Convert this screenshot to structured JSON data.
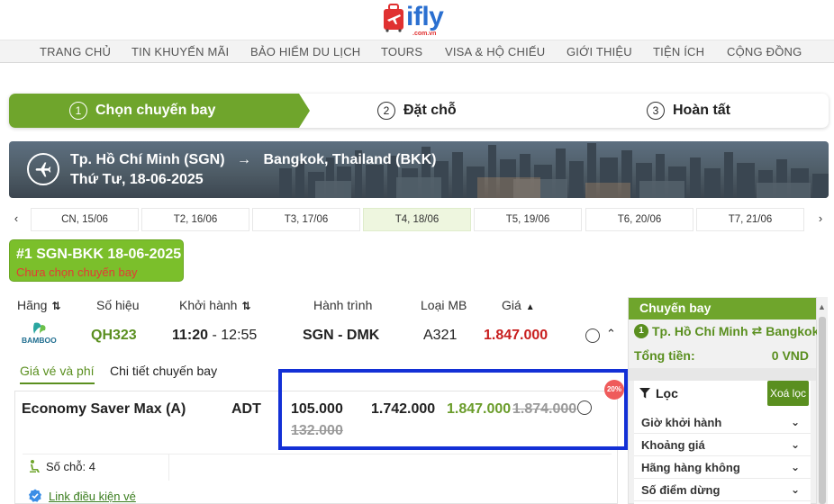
{
  "brand": {
    "logo_text": "ifly",
    "logo_sub": ".com.vn",
    "accent": "#6fa52c",
    "highlight": "#1330d6"
  },
  "nav": {
    "items": [
      "TRANG CHỦ",
      "TIN KHUYẾN MÃI",
      "BẢO HIỂM DU LỊCH",
      "TOURS",
      "VISA & HỘ CHIẾU",
      "GIỚI THIỆU",
      "TIỆN ÍCH",
      "CỘNG ĐỒNG"
    ]
  },
  "steps": [
    {
      "num": "1",
      "label": "Chọn chuyến bay"
    },
    {
      "num": "2",
      "label": "Đặt chỗ"
    },
    {
      "num": "3",
      "label": "Hoàn tất"
    }
  ],
  "route": {
    "from": "Tp. Hồ Chí Minh (SGN)",
    "arrow": "→",
    "to": "Bangkok, Thailand (BKK)",
    "date": "Thứ Tư, 18-06-2025"
  },
  "dates": {
    "prev": "‹",
    "next": "›",
    "tabs": [
      "CN, 15/06",
      "T2, 16/06",
      "T3, 17/06",
      "T4, 18/06",
      "T5, 19/06",
      "T6, 20/06",
      "T7, 21/06"
    ],
    "active_index": 3
  },
  "trip": {
    "title": "#1 SGN-BKK 18-06-2025",
    "status": "Chưa chọn chuyến bay"
  },
  "table": {
    "headers": {
      "airline": "Hãng",
      "flight_no": "Số hiệu",
      "departure": "Khởi hành",
      "itinerary": "Hành trình",
      "aircraft": "Loại MB",
      "price": "Giá"
    },
    "flight": {
      "airline_logo_text": "BAMBOO",
      "flight_no": "QH323",
      "depart": "11:20",
      "dash": "-",
      "arrive": "12:55",
      "itinerary": "SGN - DMK",
      "aircraft": "A321",
      "price": "1.847.000"
    }
  },
  "detail_tabs": [
    "Giá vé và phí",
    "Chi tiết chuyến bay"
  ],
  "fare": {
    "name": "Economy Saver Max (A)",
    "pax": "ADT",
    "tax": "105.000",
    "tax_old": "132.000",
    "base": "1.742.000",
    "total": "1.847.000",
    "total_old": "1.874.000",
    "discount": "20%",
    "seats": "Số chỗ: 4",
    "conditions_link": "Link điều kiện vé"
  },
  "sidebar": {
    "title": "Chuyến bay",
    "route_num": "1",
    "route_from": "Tp. Hồ Chí Minh",
    "route_arrow": "⇄",
    "route_to": "Bangkok",
    "total_label": "Tổng tiền:",
    "total_value": "0 VND",
    "filter_label": "Lọc",
    "clear_label": "Xoá lọc",
    "filters": [
      "Giờ khởi hành",
      "Khoảng giá",
      "Hãng hàng không",
      "Số điểm dừng"
    ]
  }
}
